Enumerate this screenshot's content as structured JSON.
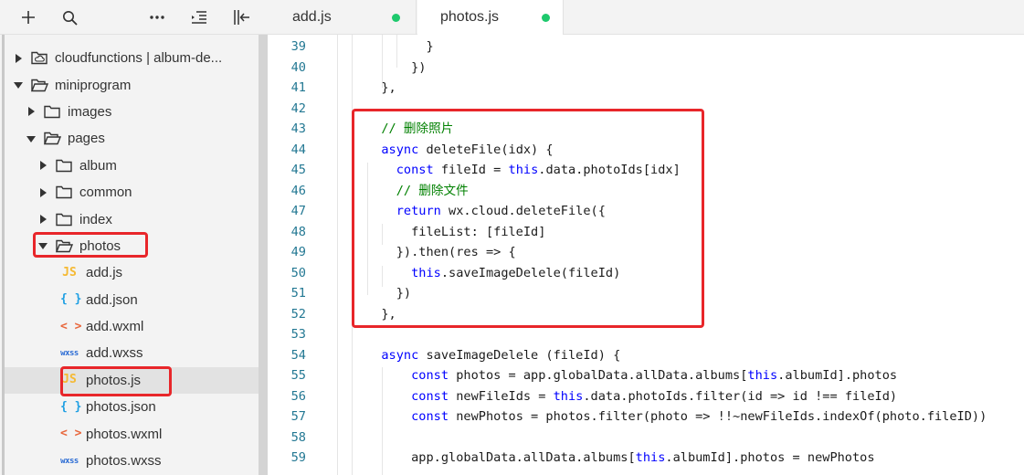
{
  "sidebar": {
    "toolbar": [
      {
        "name": "plus-icon"
      },
      {
        "name": "search-icon"
      },
      {
        "name": "more-icon"
      },
      {
        "name": "collapse-all-icon"
      },
      {
        "name": "toggle-sidebar-icon"
      }
    ],
    "tree": [
      {
        "label": "cloudfunctions | album-de...",
        "depth": 0,
        "kind": "cloud-folder",
        "expanded": false
      },
      {
        "label": "miniprogram",
        "depth": 0,
        "kind": "folder",
        "expanded": true
      },
      {
        "label": "images",
        "depth": 1,
        "kind": "folder",
        "expanded": false
      },
      {
        "label": "pages",
        "depth": 1,
        "kind": "folder",
        "expanded": true
      },
      {
        "label": "album",
        "depth": 2,
        "kind": "folder",
        "expanded": false
      },
      {
        "label": "common",
        "depth": 2,
        "kind": "folder",
        "expanded": false
      },
      {
        "label": "index",
        "depth": 2,
        "kind": "folder",
        "expanded": false
      },
      {
        "label": "photos",
        "depth": 2,
        "kind": "folder",
        "expanded": true,
        "highlight": true
      },
      {
        "label": "add.js",
        "depth": 3,
        "kind": "js"
      },
      {
        "label": "add.json",
        "depth": 3,
        "kind": "json"
      },
      {
        "label": "add.wxml",
        "depth": 3,
        "kind": "wxml"
      },
      {
        "label": "add.wxss",
        "depth": 3,
        "kind": "wxss"
      },
      {
        "label": "photos.js",
        "depth": 3,
        "kind": "js",
        "selected": true,
        "highlight": true
      },
      {
        "label": "photos.json",
        "depth": 3,
        "kind": "json"
      },
      {
        "label": "photos.wxml",
        "depth": 3,
        "kind": "wxml"
      },
      {
        "label": "photos.wxss",
        "depth": 3,
        "kind": "wxss"
      }
    ],
    "file_icons": {
      "js": "JS",
      "json": "{ }",
      "wxml": "< >",
      "wxss": "wxss"
    }
  },
  "tabs": [
    {
      "label": "add.js",
      "modified": true
    },
    {
      "label": "photos.js",
      "modified": true,
      "active": true
    }
  ],
  "colors": {
    "highlight_box": "#e8262a",
    "modified_dot": "#1ec96d",
    "keyword": "#0000ff",
    "comment": "#008000",
    "line_number": "#237893"
  },
  "editor": {
    "lines": [
      {
        "n": "39",
        "tokens": [
          [
            "p",
            "        }"
          ]
        ]
      },
      {
        "n": "40",
        "tokens": [
          [
            "p",
            "      })"
          ]
        ]
      },
      {
        "n": "41",
        "tokens": [
          [
            "p",
            "  },"
          ]
        ]
      },
      {
        "n": "42",
        "tokens": []
      },
      {
        "n": "43",
        "tokens": [
          [
            "c",
            "  // 删除照片"
          ]
        ]
      },
      {
        "n": "44",
        "tokens": [
          [
            "k",
            "  async "
          ],
          [
            "p",
            "deleteFile(idx) {"
          ]
        ]
      },
      {
        "n": "45",
        "tokens": [
          [
            "k",
            "    const "
          ],
          [
            "p",
            "fileId = "
          ],
          [
            "k",
            "this"
          ],
          [
            "p",
            ".data.photoIds[idx]"
          ]
        ]
      },
      {
        "n": "46",
        "tokens": [
          [
            "c",
            "    // 删除文件"
          ]
        ]
      },
      {
        "n": "47",
        "tokens": [
          [
            "k",
            "    return "
          ],
          [
            "p",
            "wx.cloud.deleteFile({"
          ]
        ]
      },
      {
        "n": "48",
        "tokens": [
          [
            "p",
            "      fileList: [fileId]"
          ]
        ]
      },
      {
        "n": "49",
        "tokens": [
          [
            "p",
            "    }).then(res => {"
          ]
        ]
      },
      {
        "n": "50",
        "tokens": [
          [
            "k",
            "      this"
          ],
          [
            "p",
            ".saveImageDelele(fileId)"
          ]
        ]
      },
      {
        "n": "51",
        "tokens": [
          [
            "p",
            "    })"
          ]
        ]
      },
      {
        "n": "52",
        "tokens": [
          [
            "p",
            "  },"
          ]
        ]
      },
      {
        "n": "53",
        "tokens": []
      },
      {
        "n": "54",
        "tokens": [
          [
            "k",
            "  async "
          ],
          [
            "p",
            "saveImageDelele (fileId) {"
          ]
        ]
      },
      {
        "n": "55",
        "tokens": [
          [
            "k",
            "      const "
          ],
          [
            "p",
            "photos = app.globalData.allData.albums["
          ],
          [
            "k",
            "this"
          ],
          [
            "p",
            ".albumId].photos"
          ]
        ]
      },
      {
        "n": "56",
        "tokens": [
          [
            "k",
            "      const "
          ],
          [
            "p",
            "newFileIds = "
          ],
          [
            "k",
            "this"
          ],
          [
            "p",
            ".data.photoIds.filter(id => id !== fileId)"
          ]
        ]
      },
      {
        "n": "57",
        "tokens": [
          [
            "k",
            "      const "
          ],
          [
            "p",
            "newPhotos = photos.filter(photo => !!~newFileIds.indexOf(photo.fileID))"
          ]
        ]
      },
      {
        "n": "58",
        "tokens": []
      },
      {
        "n": "59",
        "tokens": [
          [
            "p",
            "      app.globalData.allData.albums["
          ],
          [
            "k",
            "this"
          ],
          [
            "p",
            ".albumId].photos = newPhotos"
          ]
        ]
      },
      {
        "n": "",
        "tokens": []
      }
    ]
  }
}
